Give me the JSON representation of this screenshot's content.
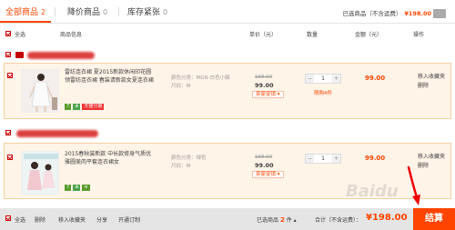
{
  "tabs": [
    {
      "label": "全部商品",
      "count": "2"
    },
    {
      "label": "降价商品",
      "count": "0"
    },
    {
      "label": "库存紧张",
      "count": "0"
    }
  ],
  "summary": {
    "label": "已选商品（不含运费）",
    "price": "¥198.00"
  },
  "header": {
    "select_all": "全选",
    "info": "商品信息",
    "unit_price": "单价（元）",
    "quantity": "数量",
    "amount": "金额（元）",
    "ops": "操作"
  },
  "items": [
    {
      "title": "雷纺连衣裙 夏2015新款休闲印花圆领雷纺连衣裙 春装请新款女夏连衣裙",
      "sku_color": "颜色分类：MGN-白色小猫",
      "sku_size": "尺码：M",
      "old_price": "168.00",
      "price": "99.00",
      "promo": "卖家促销",
      "qty": "1",
      "limit": "限购4件",
      "amount": "99.00",
      "op1": "移入收藏夹",
      "op2": "删除",
      "badges": [
        "7",
        "⊕",
        "天猫分期"
      ]
    },
    {
      "title": "2015春秋装新款 中长款修身气质优雅圆美肉平套连衣裙女",
      "sku_color": "颜色分类：绿色",
      "sku_size": "尺码：M",
      "old_price": "168.00",
      "price": "99.00",
      "promo": "卖家促销",
      "qty": "1",
      "amount": "99.00",
      "op1": "移入收藏夹",
      "op2": "删除",
      "badges": [
        "7",
        "⊕",
        "≡"
      ]
    }
  ],
  "bottom": {
    "select_all": "全选",
    "delete": "删除",
    "favorite": "移入收藏夹",
    "share": "分享",
    "open_section": "开通订制",
    "selected_label": "已选商品",
    "selected_count": "2",
    "selected_unit": "件",
    "total_label": "合计（不含运费）：",
    "total": "¥198.00",
    "checkout": "结算"
  },
  "watermark": "Baidu",
  "colors": {
    "accent": "#ff4400",
    "row_bg": "#fff4e8",
    "row_border": "#f7cfa0"
  }
}
